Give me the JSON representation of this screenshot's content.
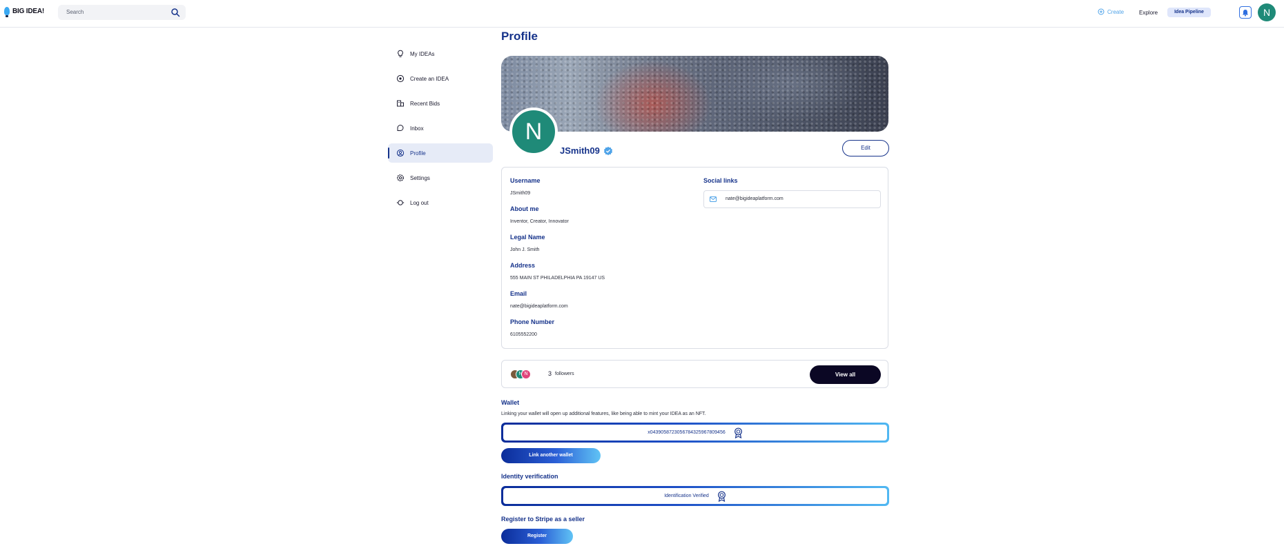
{
  "header": {
    "logo_text": "BIG IDEA!",
    "search_placeholder": "Search",
    "create_label": "Create",
    "explore_label": "Explore",
    "pipeline_label": "Idea Pipeline",
    "avatar_initial": "N"
  },
  "sidebar": {
    "items": [
      {
        "label": "My IDEAs",
        "icon": "lightbulb-icon"
      },
      {
        "label": "Create an IDEA",
        "icon": "plus-circle-icon"
      },
      {
        "label": "Recent Bids",
        "icon": "bids-icon"
      },
      {
        "label": "Inbox",
        "icon": "inbox-icon"
      },
      {
        "label": "Profile",
        "icon": "user-circle-icon",
        "active": true
      },
      {
        "label": "Settings",
        "icon": "gear-icon"
      },
      {
        "label": "Log out",
        "icon": "logout-icon"
      }
    ]
  },
  "profile": {
    "page_title": "Profile",
    "avatar_initial": "N",
    "handle": "JSmith09",
    "edit_label": "Edit",
    "fields": {
      "username_label": "Username",
      "username_value": "JSmith09",
      "about_label": "About me",
      "about_value": "Inventor, Creator, Innovator",
      "legal_label": "Legal Name",
      "legal_value": "John J. Smith",
      "address_label": "Address",
      "address_value": "555 MAIN ST PHILADELPHIA PA 19147 US",
      "email_label": "Email",
      "email_value": "nate@bigideaplatform.com",
      "phone_label": "Phone Number",
      "phone_value": "6105552200"
    },
    "social": {
      "label": "Social links",
      "email": "nate@bigideaplatform.com"
    }
  },
  "followers": {
    "count": "3",
    "word": "followers",
    "view_all_label": "View all",
    "avatars": [
      "",
      "N",
      "N"
    ]
  },
  "wallet": {
    "title": "Wallet",
    "description": "Linking your wallet will open up additional features, like being able to mint your IDEA as an NFT.",
    "address": "x0439058723056784325967809456",
    "link_button": "Link another wallet"
  },
  "identity": {
    "title": "Identity verification",
    "status": "Identification Verified"
  },
  "stripe": {
    "title": "Register to Stripe as a seller",
    "button": "Register"
  },
  "colors": {
    "brand_blue": "#15328a",
    "accent_light_blue": "#4fa3e8",
    "avatar_teal": "#1f8a78",
    "dark_button": "#0b0724"
  }
}
